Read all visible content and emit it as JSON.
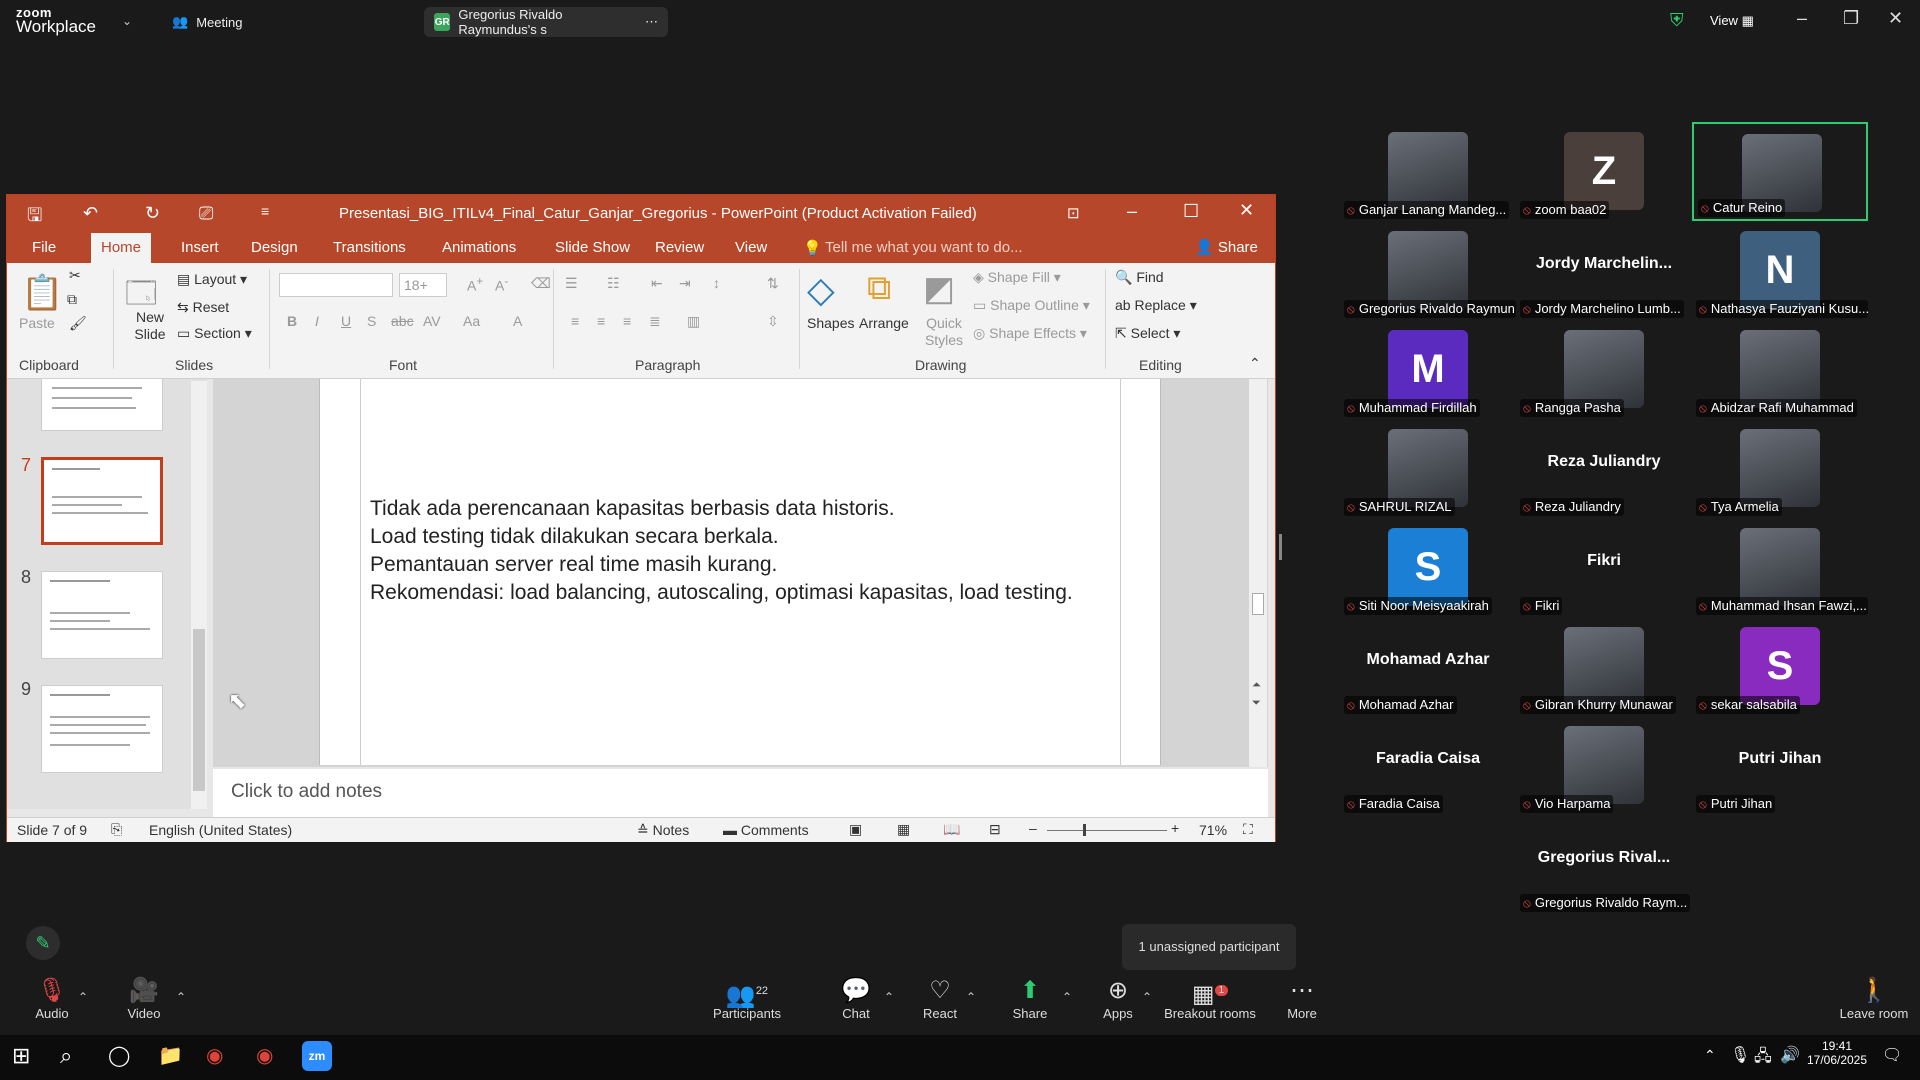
{
  "zoom": {
    "logo_top": "zoom",
    "logo_bottom": "Workplace",
    "meeting_tab": "Meeting",
    "share_tab": "Gregorius Rivaldo Raymundus's s",
    "share_badge": "GR",
    "view_label": "View",
    "unassigned_tooltip": "1 unassigned participant",
    "accent_green": "#2ecc71"
  },
  "ppt": {
    "title": "Presentasi_BIG_ITILv4_Final_Catur_Ganjar_Gregorius  -  PowerPoint (Product Activation Failed)",
    "tabs": [
      "File",
      "Home",
      "Insert",
      "Design",
      "Transitions",
      "Animations",
      "Slide Show",
      "Review",
      "View"
    ],
    "tell_me": "Tell me what you want to do...",
    "share": "Share",
    "ribbon": {
      "paste": "Paste",
      "clipboard": "Clipboard",
      "new_slide": "New Slide",
      "layout": "Layout",
      "reset": "Reset",
      "section": "Section",
      "slides": "Slides",
      "font_size": "18+",
      "font": "Font",
      "paragraph": "Paragraph",
      "shapes": "Shapes",
      "arrange": "Arrange",
      "quick_styles": "Quick Styles",
      "shape_fill": "Shape Fill",
      "shape_outline": "Shape Outline",
      "shape_effects": "Shape Effects",
      "drawing": "Drawing",
      "find": "Find",
      "replace": "Replace",
      "select": "Select",
      "editing": "Editing"
    },
    "thumb_numbers": [
      "7",
      "8",
      "9"
    ],
    "slide_lines": [
      "Tidak ada perencanaan kapasitas berbasis data historis.",
      "Load testing tidak dilakukan secara berkala.",
      "Pemantauan server real time masih kurang.",
      "Rekomendasi: load balancing, autoscaling, optimasi kapasitas, load testing."
    ],
    "notes_placeholder": "Click to add notes",
    "status": {
      "slide": "Slide 7 of 9",
      "language": "English (United States)",
      "notes": "Notes",
      "comments": "Comments",
      "zoom": "71%"
    }
  },
  "participants": [
    {
      "name": "Ganjar Lanang Mandeg...",
      "type": "video"
    },
    {
      "name": "zoom baa02",
      "type": "initial",
      "initial": "Z",
      "color": "#4a3f3a"
    },
    {
      "name": "Catur Reino",
      "type": "video",
      "active": true
    },
    {
      "name": "Gregorius Rivaldo Raymun...",
      "type": "video"
    },
    {
      "name": "Jordy Marchelino Lumb...",
      "type": "text",
      "big": "Jordy  Marchelin..."
    },
    {
      "name": "Nathasya Fauziyani Kusu...",
      "type": "initial",
      "initial": "N",
      "color": "#3f5f7f"
    },
    {
      "name": "Muhammad Firdillah",
      "type": "initial",
      "initial": "M",
      "color": "#5b2bbf"
    },
    {
      "name": "Rangga Pasha",
      "type": "video"
    },
    {
      "name": "Abidzar Rafi Muhammad",
      "type": "video"
    },
    {
      "name": "SAHRUL RIZAL",
      "type": "video"
    },
    {
      "name": "Reza Juliandry",
      "type": "text",
      "big": "Reza Juliandry"
    },
    {
      "name": "Tya Armelia",
      "type": "video"
    },
    {
      "name": "Siti Noor Meisyaakirah",
      "type": "initial",
      "initial": "S",
      "color": "#1b7fd6"
    },
    {
      "name": "Fikri",
      "type": "text",
      "big": "Fikri"
    },
    {
      "name": "Muhammad Ihsan Fawzi,...",
      "type": "video"
    },
    {
      "name": "Mohamad Azhar",
      "type": "text",
      "big": "Mohamad Azhar"
    },
    {
      "name": "Gibran Khurry Munawar",
      "type": "video"
    },
    {
      "name": "sekar salsabila",
      "type": "initial",
      "initial": "S",
      "color": "#8a2bbf"
    },
    {
      "name": "Faradia Caisa",
      "type": "text",
      "big": "Faradia Caisa"
    },
    {
      "name": "Vio Harpama",
      "type": "video"
    },
    {
      "name": "Putri Jihan",
      "type": "text",
      "big": "Putri Jihan"
    },
    {
      "name": "Gregorius Rivaldo Raym...",
      "type": "text",
      "big": "Gregorius  Rival..."
    }
  ],
  "toolbar": {
    "audio": "Audio",
    "video": "Video",
    "participants": "Participants",
    "participants_count": "22",
    "chat": "Chat",
    "react": "React",
    "share": "Share",
    "apps": "Apps",
    "breakout": "Breakout rooms",
    "breakout_badge": "1",
    "more": "More",
    "leave": "Leave room"
  },
  "taskbar": {
    "time": "19:41",
    "date": "17/06/2025"
  }
}
